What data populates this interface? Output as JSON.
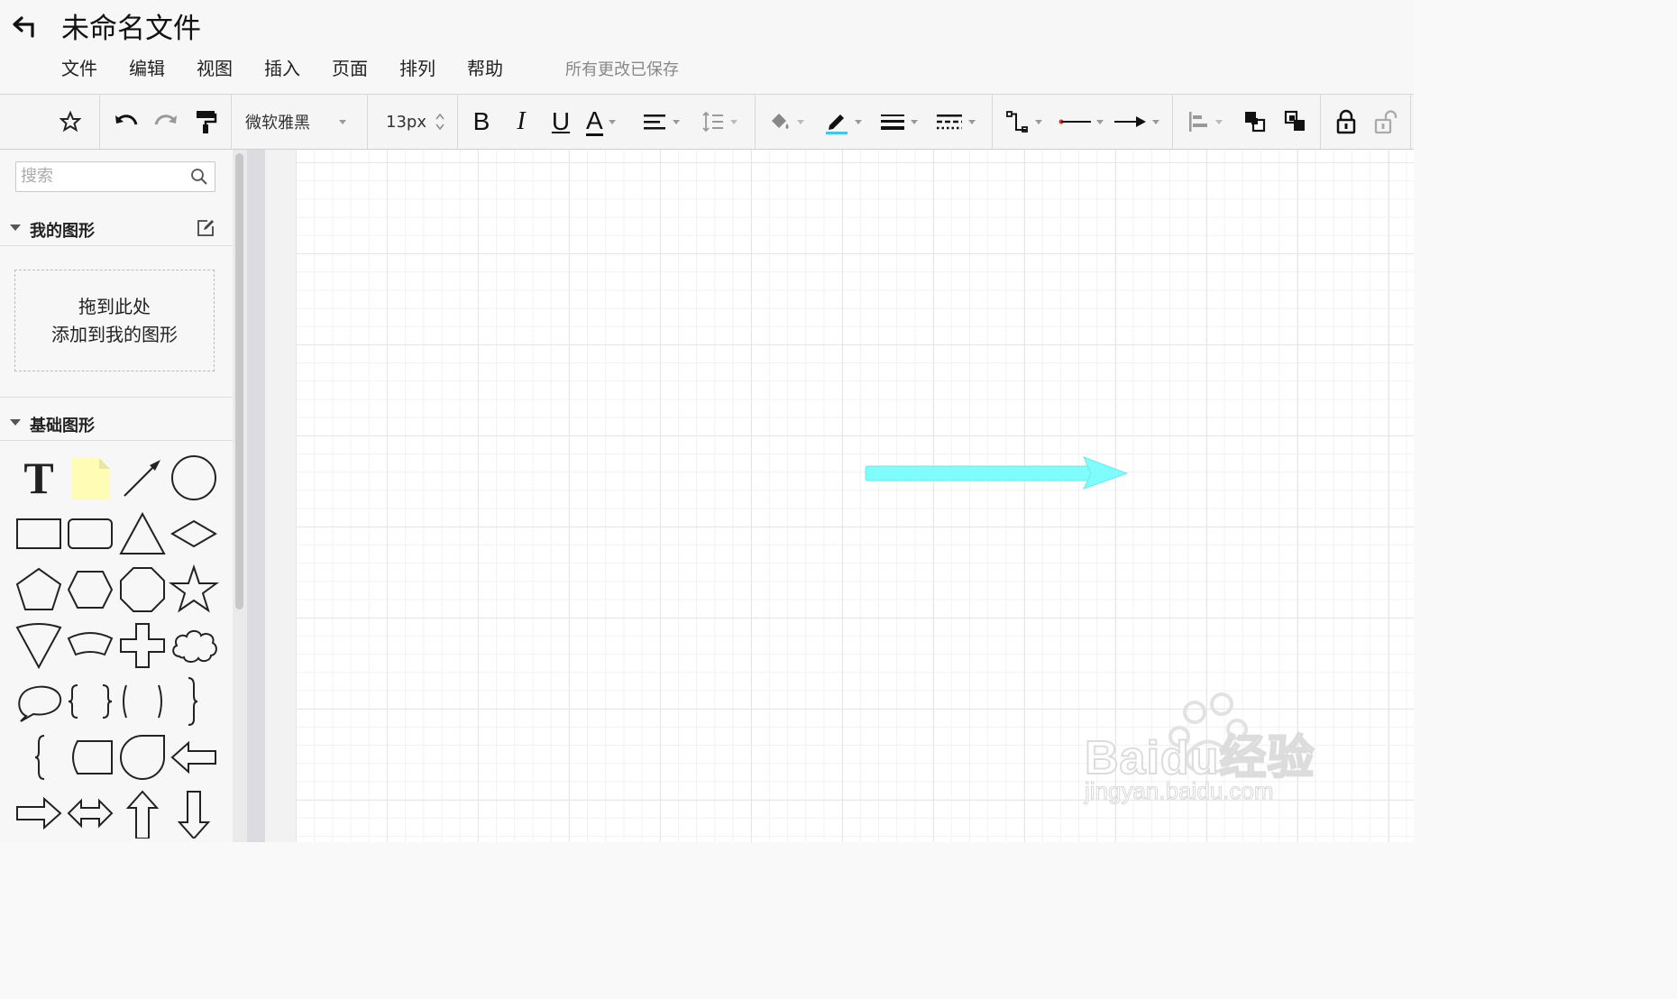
{
  "document": {
    "title": "未命名文件",
    "save_status": "所有更改已保存"
  },
  "menu": [
    "文件",
    "编辑",
    "视图",
    "插入",
    "页面",
    "排列",
    "帮助"
  ],
  "toolbar": {
    "font_family": "微软雅黑",
    "font_size": "13px",
    "bold_label": "B",
    "italic_label": "I",
    "underline_label": "U",
    "font_color_label": "A",
    "line_color": "#3ec7ee",
    "icons": [
      "pin-icon",
      "undo-icon",
      "redo-icon",
      "format-painter-icon",
      "bold-icon",
      "italic-icon",
      "underline-icon",
      "font-color-icon",
      "text-align-icon",
      "line-spacing-icon",
      "fill-color-icon",
      "line-color-icon",
      "line-width-icon",
      "line-style-icon",
      "connector-type-icon",
      "line-start-icon",
      "line-end-icon",
      "align-icon",
      "bring-front-icon",
      "send-back-icon",
      "lock-icon",
      "unlock-icon"
    ]
  },
  "sidebar": {
    "search_placeholder": "搜索",
    "my_shapes": {
      "title": "我的图形",
      "drop_line1": "拖到此处",
      "drop_line2": "添加到我的图形"
    },
    "basic_shapes": {
      "title": "基础图形",
      "text_shape_label": "T"
    }
  },
  "canvas": {
    "shape": {
      "type": "arrow",
      "fill": "#7ffcfc"
    }
  },
  "watermark": {
    "brand": "Baidu经验",
    "url": "jingyan.baidu.com"
  }
}
